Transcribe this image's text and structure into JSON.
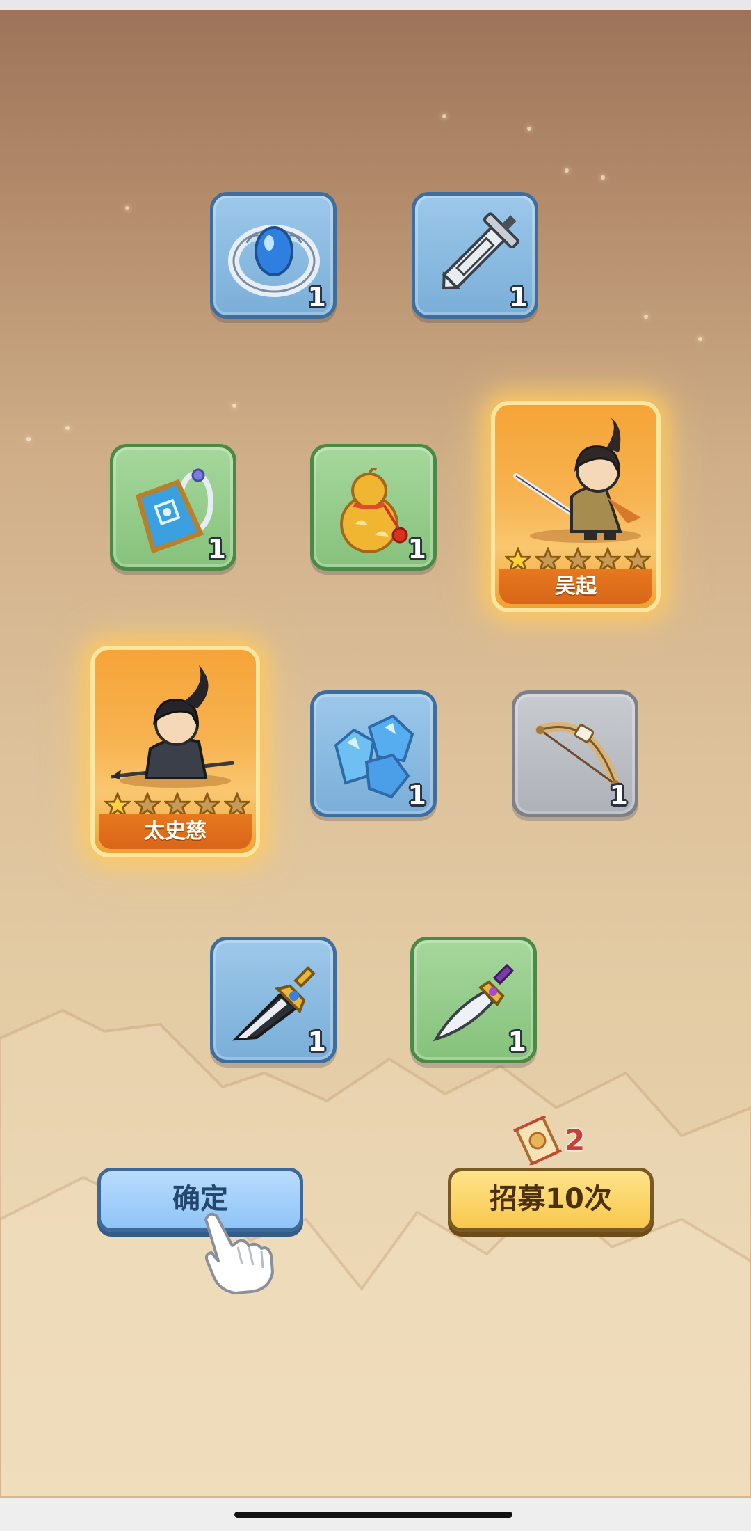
{
  "rewards": {
    "items": [
      {
        "icon": "ring-icon",
        "rarity": "blue",
        "count": "1"
      },
      {
        "icon": "sword-icon",
        "rarity": "blue",
        "count": "1"
      },
      {
        "icon": "token-icon",
        "rarity": "green",
        "count": "1"
      },
      {
        "icon": "gourd-icon",
        "rarity": "green",
        "count": "1"
      },
      {
        "icon": "crystals-icon",
        "rarity": "blue",
        "count": "1"
      },
      {
        "icon": "bow-icon",
        "rarity": "gray",
        "count": "1"
      },
      {
        "icon": "broadsword-icon",
        "rarity": "blue",
        "count": "1"
      },
      {
        "icon": "dagger-icon",
        "rarity": "green",
        "count": "1"
      }
    ],
    "heroes": [
      {
        "name": "吴起",
        "stars_filled": 1,
        "stars_total": 5
      },
      {
        "name": "太史慈",
        "stars_filled": 1,
        "stars_total": 5
      }
    ]
  },
  "actions": {
    "confirm_label": "确定",
    "recruit_label": "招募10次",
    "recruit_cost": "2",
    "recruit_cost_icon": "recruit-scroll-icon"
  },
  "colors": {
    "blue_tile": "#7aaed8",
    "green_tile": "#86c27c",
    "gray_tile": "#aeb2b8",
    "hero_card": "#f6a437",
    "confirm_button": "#8ec4f7",
    "recruit_button": "#f7c94c"
  }
}
